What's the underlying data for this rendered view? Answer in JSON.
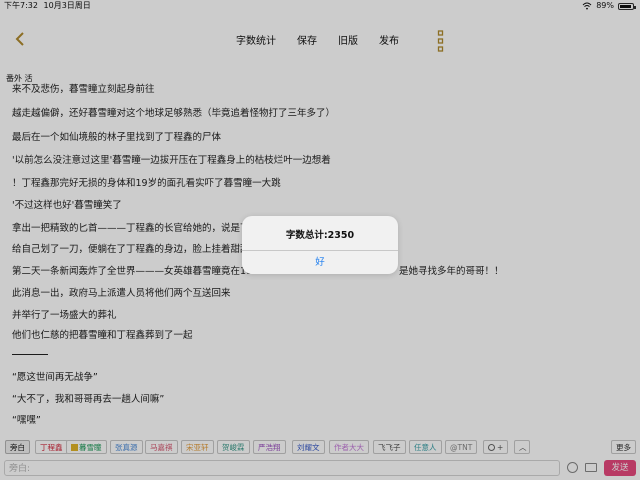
{
  "status": {
    "time": "下午7:32",
    "date": "10月3日周日",
    "battery": "89%",
    "battery_level": 0.89
  },
  "nav": {
    "actions": [
      "字数统计",
      "保存",
      "旧版",
      "发布"
    ],
    "back_icon": "chevron-left-icon",
    "more_icon": "vertical-dots-icon",
    "accent": "#b08a2e"
  },
  "chapter": {
    "title": "番外 活"
  },
  "editor": {
    "lines": [
      "来不及悲伤，暮雪瞳立刻起身前往",
      "越走越偏僻，还好暮雪瞳对这个地球足够熟悉（毕竟追着怪物打了三年多了）",
      "最后在一个如仙境般的林子里找到了丁程鑫的尸体",
      "'以前怎么没注意过这里'暮雪瞳一边拔开压在丁程鑫身上的枯枝烂叶一边想着",
      "！丁程鑫那完好无损的身体和19岁的面孔看实吓了暮雪瞳一大跳",
      "'不过这样也好'暮雪瞳笑了",
      "拿出一把精致的匕首———丁程鑫的长官给她的，说是丁",
      "给自己划了一刀，便躺在了丁程鑫的身边，脸上挂着甜甜",
      "第二天一条新闻轰炸了全世界———女英雄暮雪瞳竟在18",
      "此消息一出，政府马上派遣人员将他们两个互送回来",
      "并举行了一场盛大的葬礼",
      "他们也仁慈的把暮雪瞳和丁程鑫葬到了一起",
      "",
      "“愿这世间再无战争”",
      "“大不了，我和哥哥再去一趟人间嘛”",
      "“嘿嘿”"
    ],
    "line9_tail": "是她寻找多年的哥哥！！"
  },
  "roles": {
    "items": [
      {
        "label": "旁白",
        "color": "#333333"
      },
      {
        "label": "丁程鑫",
        "color": "#d2283c"
      },
      {
        "label": "暮雪瞳",
        "color": "#1f9a5a"
      },
      {
        "label": "张真源",
        "color": "#4a8ad8"
      },
      {
        "label": "马嘉祺",
        "color": "#d44f6a"
      },
      {
        "label": "宋亚轩",
        "color": "#e39c3a"
      },
      {
        "label": "贺峻霖",
        "color": "#3a9a8a"
      },
      {
        "label": "严浩翔",
        "color": "#9b4fc0"
      },
      {
        "label": "刘耀文",
        "color": "#3a5cc9"
      },
      {
        "label": "作者大大",
        "color": "#c47ad9"
      },
      {
        "label": "飞飞子",
        "color": "#555555"
      },
      {
        "label": "任意人",
        "color": "#3aa0a8"
      },
      {
        "label": "@TNT",
        "color": "#888888"
      }
    ],
    "add_label": "+",
    "more_label": "更多"
  },
  "input": {
    "placeholder": "旁白:",
    "send_label": "发送",
    "send_color": "#e6497e"
  },
  "dialog": {
    "message": "字数总计:2350",
    "button": "好"
  }
}
